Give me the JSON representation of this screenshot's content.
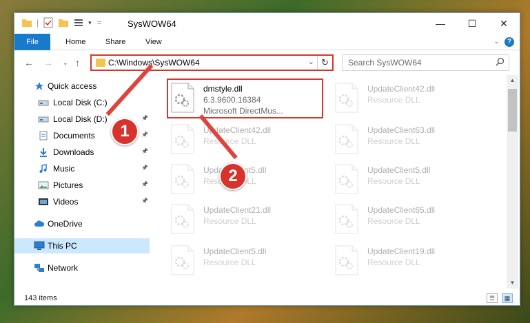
{
  "window": {
    "title": "SysWOW64",
    "controls": [
      "minimize",
      "maximize",
      "close"
    ]
  },
  "ribbon": {
    "tabs": [
      "File",
      "Home",
      "Share",
      "View"
    ],
    "help_icon": "?"
  },
  "nav": {
    "address_path": "C:\\Windows\\SysWOW64",
    "search_placeholder": "Search SysWOW64"
  },
  "sidebar": {
    "items": [
      {
        "label": "Quick access",
        "icon": "star-icon",
        "pinned": false
      },
      {
        "label": "Local Disk (C:)",
        "icon": "drive-icon",
        "pinned": false
      },
      {
        "label": "Local Disk (D:)",
        "icon": "drive-icon",
        "pinned": true
      },
      {
        "label": "Documents",
        "icon": "documents-icon",
        "pinned": true
      },
      {
        "label": "Downloads",
        "icon": "download-icon",
        "pinned": true
      },
      {
        "label": "Music",
        "icon": "music-icon",
        "pinned": true
      },
      {
        "label": "Pictures",
        "icon": "pictures-icon",
        "pinned": true
      },
      {
        "label": "Videos",
        "icon": "videos-icon",
        "pinned": true
      },
      {
        "label": "OneDrive",
        "icon": "cloud-icon",
        "pinned": false
      },
      {
        "label": "This PC",
        "icon": "computer-icon",
        "pinned": false,
        "selected": true
      },
      {
        "label": "Network",
        "icon": "network-icon",
        "pinned": false
      }
    ]
  },
  "files": [
    {
      "name": "dmstyle.dll",
      "line1": "6.3.9600.16384",
      "line2": "Microsoft DirectMus...",
      "highlighted": true
    },
    {
      "name": "UpdateClient42.dll",
      "line1": "Resource DLL"
    },
    {
      "name": "UpdateClient42.dll",
      "line1": "Resource DLL"
    },
    {
      "name": "UpdateClient63.dll",
      "line1": "Resource DLL"
    },
    {
      "name": "UpdateClient5.dll",
      "line1": "Resource DLL"
    },
    {
      "name": "UpdateClient5.dll",
      "line1": "Resource DLL"
    },
    {
      "name": "UpdateClient21.dll",
      "line1": "Resource DLL"
    },
    {
      "name": "UpdateClient65.dll",
      "line1": "Resource DLL"
    },
    {
      "name": "UpdateClient5.dll",
      "line1": "Resource DLL"
    },
    {
      "name": "UpdateClient19.dll",
      "line1": "Resource DLL"
    }
  ],
  "status": {
    "item_count": "143 items"
  },
  "callouts": [
    "1",
    "2"
  ],
  "colors": {
    "accent": "#1979ca",
    "highlight": "#d9342b",
    "selected_bg": "#cce8ff"
  }
}
